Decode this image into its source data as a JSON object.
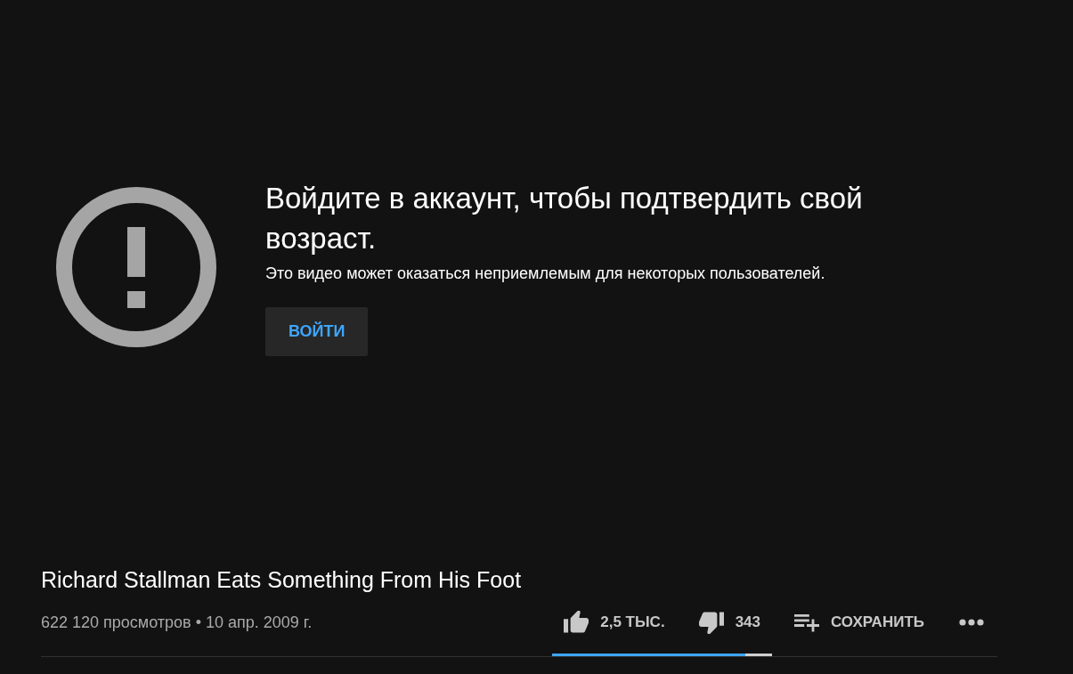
{
  "age_gate": {
    "title": "Войдите в аккаунт, чтобы подтвердить свой возраст.",
    "message": "Это видео может оказаться неприемлемым для некоторых пользователей.",
    "button": "ВОЙТИ"
  },
  "video": {
    "title": "Richard Stallman Eats Something From His Foot",
    "info": "622 120 просмотров • 10 апр. 2009 г.",
    "actions": [
      {
        "kind": "like",
        "label": "2,5 ТЫС."
      },
      {
        "kind": "dislike",
        "label": "343"
      },
      {
        "kind": "save",
        "label": "СОХРАНИТЬ"
      },
      {
        "kind": "more"
      }
    ],
    "sentiment": {
      "level": 0.88
    }
  }
}
